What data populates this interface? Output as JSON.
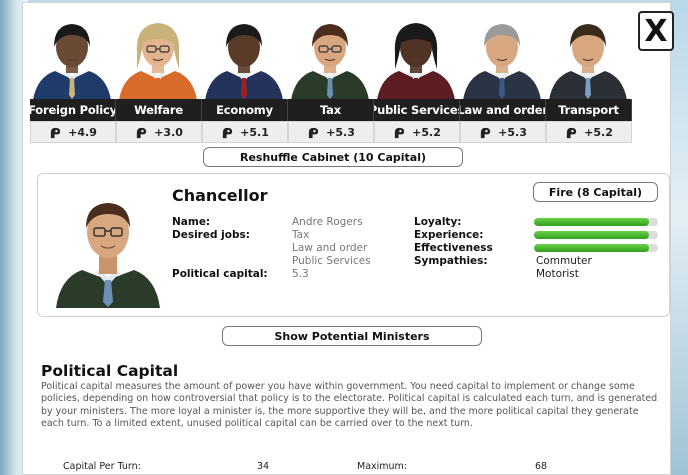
{
  "ministers": [
    {
      "label": "Foreign Policy",
      "capital": "+4.9",
      "skin": "#6b4a35",
      "suit": "#1f3b6a",
      "hair": "#1a1a1a",
      "tie": "#c9b37a",
      "glasses": false
    },
    {
      "label": "Welfare",
      "capital": "+3.0",
      "skin": "#e2b48f",
      "suit": "#d86a2a",
      "hair": "#c9b27a",
      "tie": "#d86a2a",
      "glasses": true
    },
    {
      "label": "Economy",
      "capital": "+5.1",
      "skin": "#5a3a28",
      "suit": "#23335c",
      "hair": "#1a1a1a",
      "tie": "#a32020",
      "glasses": false
    },
    {
      "label": "Tax",
      "capital": "+5.3",
      "skin": "#d9a77f",
      "suit": "#2b3b2a",
      "hair": "#4a2d1c",
      "tie": "#6c8fb8",
      "glasses": true
    },
    {
      "label": "Public Services",
      "capital": "+5.2",
      "skin": "#4f3324",
      "suit": "#5c1e22",
      "hair": "#1a1a1a",
      "tie": "#5c1e22",
      "glasses": false
    },
    {
      "label": "Law and order",
      "capital": "+5.3",
      "skin": "#d8a882",
      "suit": "#2a3444",
      "hair": "#9b9b9b",
      "tie": "#3c5a88",
      "glasses": false
    },
    {
      "label": "Transport",
      "capital": "+5.2",
      "skin": "#d9a77f",
      "suit": "#2b2f36",
      "hair": "#3a2a1c",
      "tie": "#7aa0c8",
      "glasses": false
    }
  ],
  "reshuffle_label": "Reshuffle Cabinet (10 Capital)",
  "close_label": "X",
  "selected": {
    "role": "Chancellor",
    "fire_label": "Fire (8 Capital)",
    "name_label": "Name:",
    "name_value": "Andre Rogers",
    "desired_label": "Desired jobs:",
    "desired_jobs": [
      "Tax",
      "Law and order",
      "Public Services"
    ],
    "capital_label": "Political capital:",
    "capital_value": "5.3",
    "loyalty_label": "Loyalty:",
    "loyalty": 0.93,
    "experience_label": "Experience:",
    "experience": 0.93,
    "effectiveness_label": "Effectiveness",
    "effectiveness": 0.93,
    "sympathies_label": "Sympathies:",
    "sympathies": [
      "Commuter",
      "Motorist"
    ]
  },
  "show_ministers_label": "Show Potential Ministers",
  "political_capital": {
    "title": "Political Capital",
    "body": "Political capital measures the amount of power you have within government. You need capital to implement or change some policies, depending on how controversial that policy is to the electorate. Political capital is calculated each turn, and is generated by your ministers. The more loyal a minister is, the more supportive they will be, and the more political capital they generate each turn. To a limited extent, unused political capital can be carried over to the next turn.",
    "per_turn_label": "Capital Per Turn:",
    "per_turn_value": "34",
    "maximum_label": "Maximum:",
    "maximum_value": "68"
  },
  "colors": {
    "bar": "#3cb526",
    "tab_bg": "#1f1f1f"
  }
}
